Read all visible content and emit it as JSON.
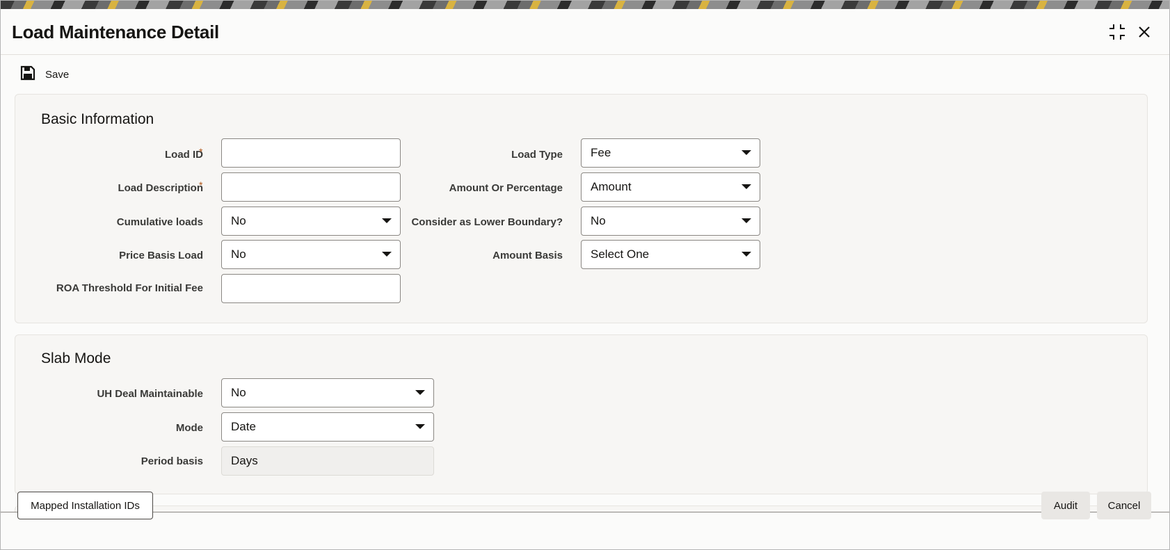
{
  "window": {
    "title": "Load Maintenance Detail",
    "controls": {
      "minimize_icon": "collapse-icon",
      "close_icon": "close-icon"
    }
  },
  "toolbar": {
    "save_label": "Save",
    "save_icon": "floppy-disk-icon"
  },
  "basic_information": {
    "heading": "Basic Information",
    "left": [
      {
        "label": "Load ID",
        "required": "*",
        "type": "text",
        "value": ""
      },
      {
        "label": "Load Description",
        "required": "*",
        "type": "text",
        "value": ""
      },
      {
        "label": "Cumulative loads",
        "type": "select",
        "value": "No"
      },
      {
        "label": "Price Basis Load",
        "type": "select",
        "value": "No"
      },
      {
        "label": "ROA Threshold For Initial Fee",
        "type": "text",
        "value": ""
      }
    ],
    "right": [
      {
        "label": "Load Type",
        "type": "select",
        "value": "Fee"
      },
      {
        "label": "Amount Or Percentage",
        "type": "select",
        "value": "Amount"
      },
      {
        "label": "Consider as Lower Boundary?",
        "type": "select",
        "value": "No"
      },
      {
        "label": "Amount Basis",
        "type": "select",
        "value": "Select One"
      }
    ]
  },
  "slab_mode": {
    "heading": "Slab Mode",
    "fields": [
      {
        "label": "UH Deal Maintainable",
        "type": "select",
        "value": "No"
      },
      {
        "label": "Mode",
        "type": "select",
        "value": "Date"
      },
      {
        "label": "Period basis",
        "type": "readonly",
        "value": "Days"
      }
    ]
  },
  "footer": {
    "mapped_button": "Mapped Installation IDs",
    "audit_button": "Audit",
    "cancel_button": "Cancel"
  },
  "colors": {
    "required_marker": "#b1571a",
    "panel_background": "#f7f6f4",
    "field_border": "#8a8783"
  }
}
